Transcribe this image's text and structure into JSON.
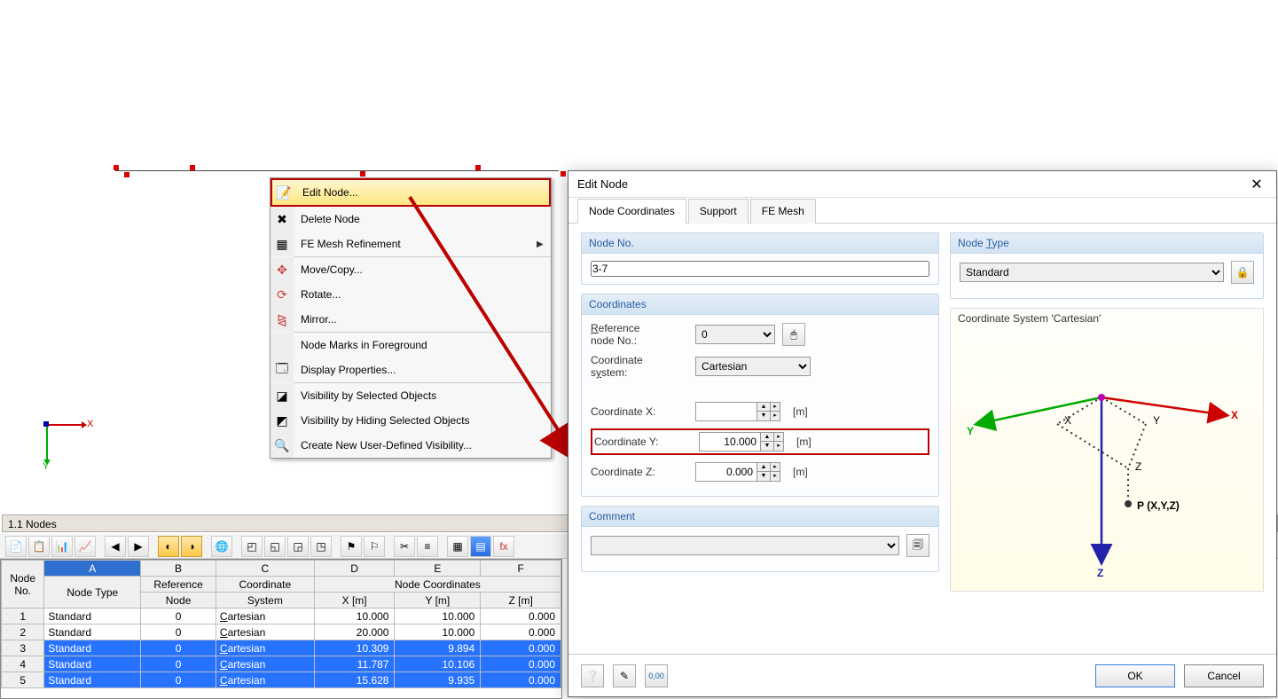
{
  "viewport": {
    "axis_x_label": "X",
    "axis_y_label": "Y"
  },
  "context_menu": {
    "items": [
      {
        "label": "Edit Node...",
        "highlighted": true
      },
      {
        "label": "Delete Node"
      },
      {
        "label": "FE Mesh Refinement",
        "submenu": true
      },
      {
        "sep": true
      },
      {
        "label": "Move/Copy..."
      },
      {
        "label": "Rotate..."
      },
      {
        "label": "Mirror..."
      },
      {
        "sep": true
      },
      {
        "label": "Node Marks in Foreground"
      },
      {
        "label": "Display Properties..."
      },
      {
        "sep": true
      },
      {
        "label": "Visibility by Selected Objects"
      },
      {
        "label": "Visibility by Hiding Selected Objects"
      },
      {
        "label": "Create New User-Defined Visibility..."
      }
    ]
  },
  "panel_title": "1.1 Nodes",
  "table": {
    "col_letters": [
      "A",
      "B",
      "C",
      "D",
      "E",
      "F"
    ],
    "corner": "Node No.",
    "headers_row1": [
      "Node Type",
      "Reference",
      "Coordinate",
      "Node Coordinates"
    ],
    "headers_row2": [
      "",
      "Node",
      "System",
      "X [m]",
      "Y [m]",
      "Z [m]"
    ],
    "rows": [
      {
        "no": "1",
        "type": "Standard",
        "ref": "0",
        "cs": "Cartesian",
        "x": "10.000",
        "y": "10.000",
        "z": "0.000",
        "sel": false
      },
      {
        "no": "2",
        "type": "Standard",
        "ref": "0",
        "cs": "Cartesian",
        "x": "20.000",
        "y": "10.000",
        "z": "0.000",
        "sel": false
      },
      {
        "no": "3",
        "type": "Standard",
        "ref": "0",
        "cs": "Cartesian",
        "x": "10.309",
        "y": "9.894",
        "z": "0.000",
        "sel": true
      },
      {
        "no": "4",
        "type": "Standard",
        "ref": "0",
        "cs": "Cartesian",
        "x": "11.787",
        "y": "10.106",
        "z": "0.000",
        "sel": true
      },
      {
        "no": "5",
        "type": "Standard",
        "ref": "0",
        "cs": "Cartesian",
        "x": "15.628",
        "y": "9.935",
        "z": "0.000",
        "sel": true
      }
    ]
  },
  "dialog": {
    "title": "Edit Node",
    "tabs": [
      "Node Coordinates",
      "Support",
      "FE Mesh"
    ],
    "active_tab": 0,
    "node_no": {
      "label": "Node No.",
      "value": "3-7"
    },
    "node_type": {
      "label": "Node Type",
      "value": "Standard"
    },
    "coords_group": "Coordinates",
    "ref_node": {
      "label": "Reference node No.:",
      "value": "0"
    },
    "coord_system": {
      "label": "Coordinate system:",
      "value": "Cartesian"
    },
    "coord_x": {
      "label": "Coordinate X:",
      "value": "",
      "unit": "[m]"
    },
    "coord_y": {
      "label": "Coordinate Y:",
      "value": "10.000",
      "unit": "[m]"
    },
    "coord_z": {
      "label": "Coordinate Z:",
      "value": "0.000",
      "unit": "[m]"
    },
    "comment_group": "Comment",
    "comment_value": "",
    "cs_preview_title": "Coordinate System 'Cartesian'",
    "cs_labels": {
      "x": "X",
      "y": "Y",
      "z": "Z",
      "p": "P (X,Y,Z)",
      "xlow": "X",
      "ylow": "Y"
    },
    "ok": "OK",
    "cancel": "Cancel"
  }
}
